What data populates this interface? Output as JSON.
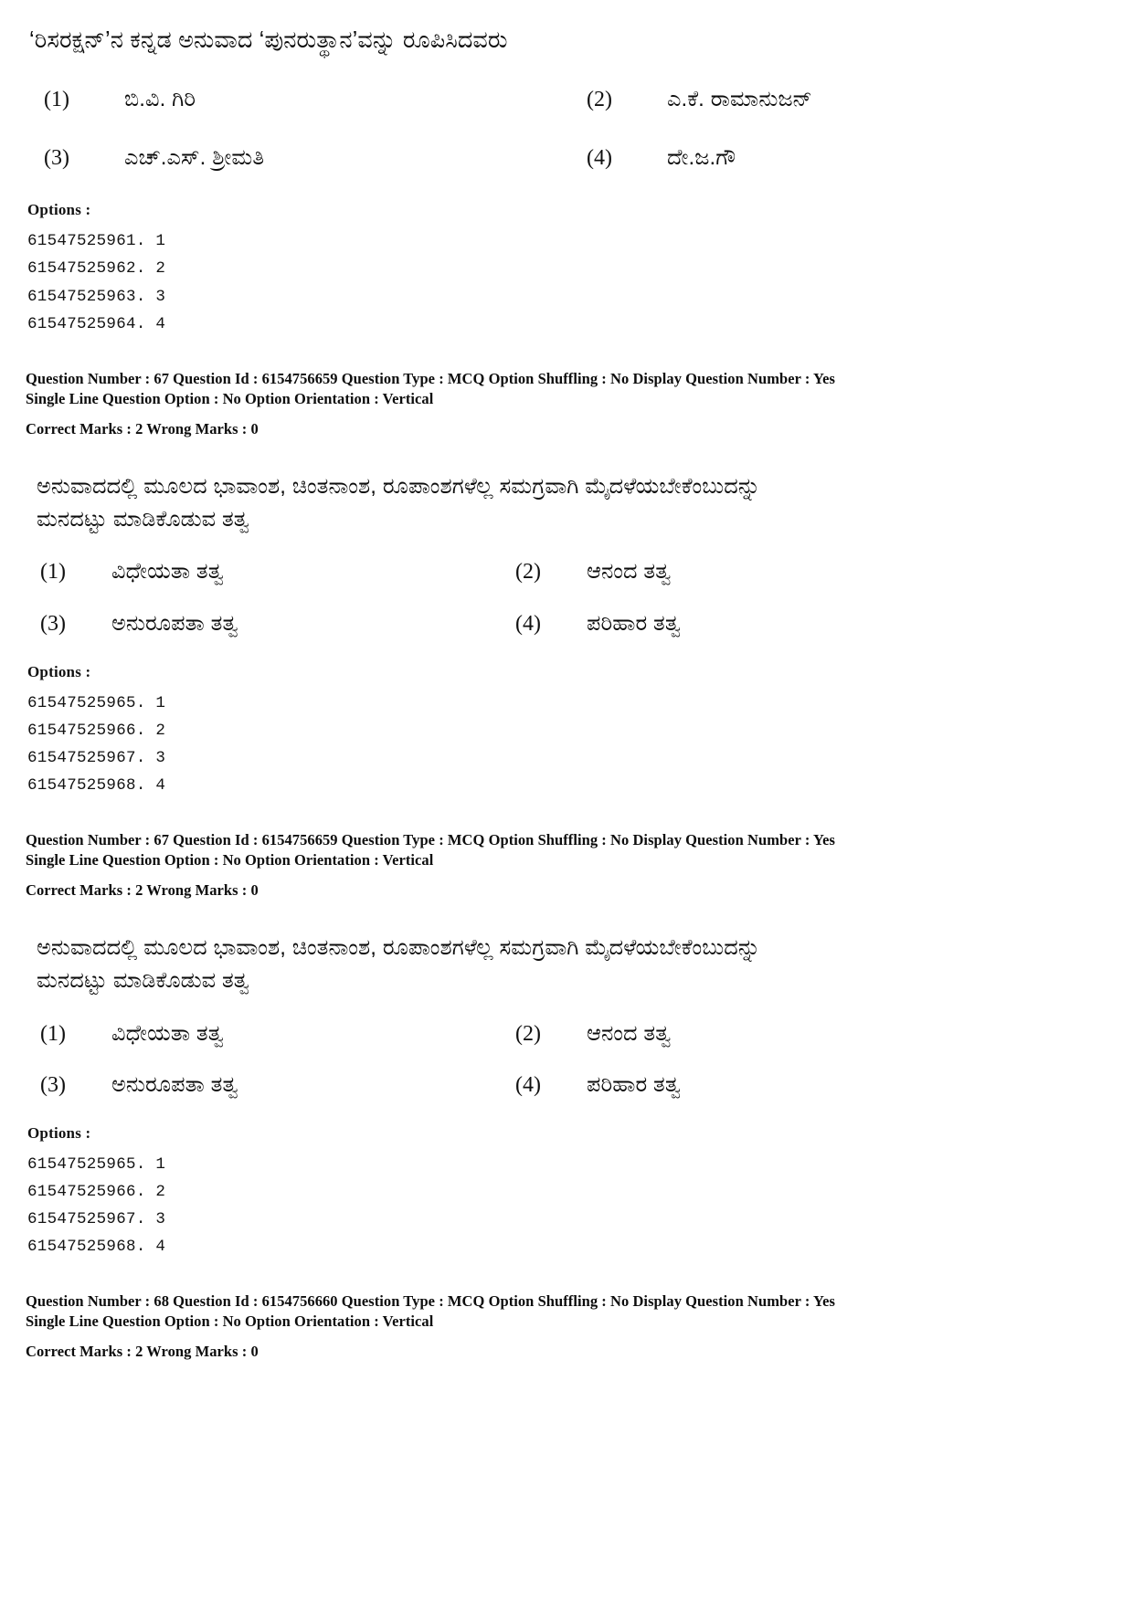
{
  "document": {
    "type": "exam-question-paper",
    "language": "Kannada",
    "background_color": "#ffffff",
    "text_color": "#111111"
  },
  "question_66": {
    "prompt": "‘ರಿಸರಕ್ಷನ್’ನ ಕನ್ನಡ ಅನುವಾದ ‘ಪುನರುತ್ಥಾನ’ವನ್ನು ರೂಪಿಸಿದವರು",
    "choices": [
      {
        "num": "(1)",
        "text": "ಬಿ.ವಿ. ಗಿರಿ"
      },
      {
        "num": "(2)",
        "text": "ಎ.ಕೆ. ರಾಮಾನುಜನ್"
      },
      {
        "num": "(3)",
        "text": "ಎಚ್.ಎಸ್. ಶ್ರೀಮತಿ"
      },
      {
        "num": "(4)",
        "text": "ದೇ.ಜ.ಗೌ"
      }
    ],
    "options_label": "Options :",
    "option_ids": [
      "61547525961. 1",
      "61547525962. 2",
      "61547525963. 3",
      "61547525964. 4"
    ]
  },
  "meta_67_first": {
    "line1": "Question Number : 67  Question Id : 6154756659  Question Type : MCQ  Option Shuffling : No  Display Question Number : Yes",
    "line2": "Single Line Question Option : No  Option Orientation : Vertical",
    "line3": "Correct Marks : 2  Wrong Marks : 0"
  },
  "question_67": {
    "body_line1": "ಅನುವಾದದಲ್ಲಿ   ಮೂಲದ   ಭಾವಾಂಶ,   ಚಿಂತನಾಂಶ,   ರೂಪಾಂಶಗಳೆಲ್ಲ   ಸಮಗ್ರವಾಗಿ   ಮೈದಳೆಯಬೇಕೆಂಬುದನ್ನು",
    "body_line2": "ಮನದಟ್ಟು ಮಾಡಿಕೊಡುವ ತತ್ವ",
    "choices": [
      {
        "num": "(1)",
        "text": "ವಿಧೇಯತಾ ತತ್ವ"
      },
      {
        "num": "(2)",
        "text": "ಆನಂದ ತತ್ವ"
      },
      {
        "num": "(3)",
        "text": "ಅನುರೂಪತಾ ತತ್ವ"
      },
      {
        "num": "(4)",
        "text": "ಪರಿಹಾರ ತತ್ವ"
      }
    ],
    "options_label": "Options :",
    "option_ids": [
      "61547525965. 1",
      "61547525966. 2",
      "61547525967. 3",
      "61547525968. 4"
    ]
  },
  "meta_67_second": {
    "line1": "Question Number : 67  Question Id : 6154756659  Question Type : MCQ  Option Shuffling : No  Display Question Number : Yes",
    "line2": "Single Line Question Option : No  Option Orientation : Vertical",
    "line3": "Correct Marks : 2  Wrong Marks : 0"
  },
  "question_67_repeat": {
    "body_line1": "ಅನುವಾದದಲ್ಲಿ   ಮೂಲದ   ಭಾವಾಂಶ,   ಚಿಂತನಾಂಶ,   ರೂಪಾಂಶಗಳೆಲ್ಲ   ಸಮಗ್ರವಾಗಿ   ಮೈದಳೆಯಬೇಕೆಂಬುದನ್ನು",
    "body_line2": "ಮನದಟ್ಟು ಮಾಡಿಕೊಡುವ ತತ್ವ",
    "choices": [
      {
        "num": "(1)",
        "text": "ವಿಧೇಯತಾ ತತ್ವ"
      },
      {
        "num": "(2)",
        "text": "ಆನಂದ ತತ್ವ"
      },
      {
        "num": "(3)",
        "text": "ಅನುರೂಪತಾ ತತ್ವ"
      },
      {
        "num": "(4)",
        "text": "ಪರಿಹಾರ ತತ್ವ"
      }
    ],
    "options_label": "Options :",
    "option_ids": [
      "61547525965. 1",
      "61547525966. 2",
      "61547525967. 3",
      "61547525968. 4"
    ]
  },
  "meta_68": {
    "line1": "Question Number : 68  Question Id : 6154756660  Question Type : MCQ  Option Shuffling : No  Display Question Number : Yes",
    "line2": "Single Line Question Option : No  Option Orientation : Vertical",
    "line3": "Correct Marks : 2  Wrong Marks : 0"
  }
}
